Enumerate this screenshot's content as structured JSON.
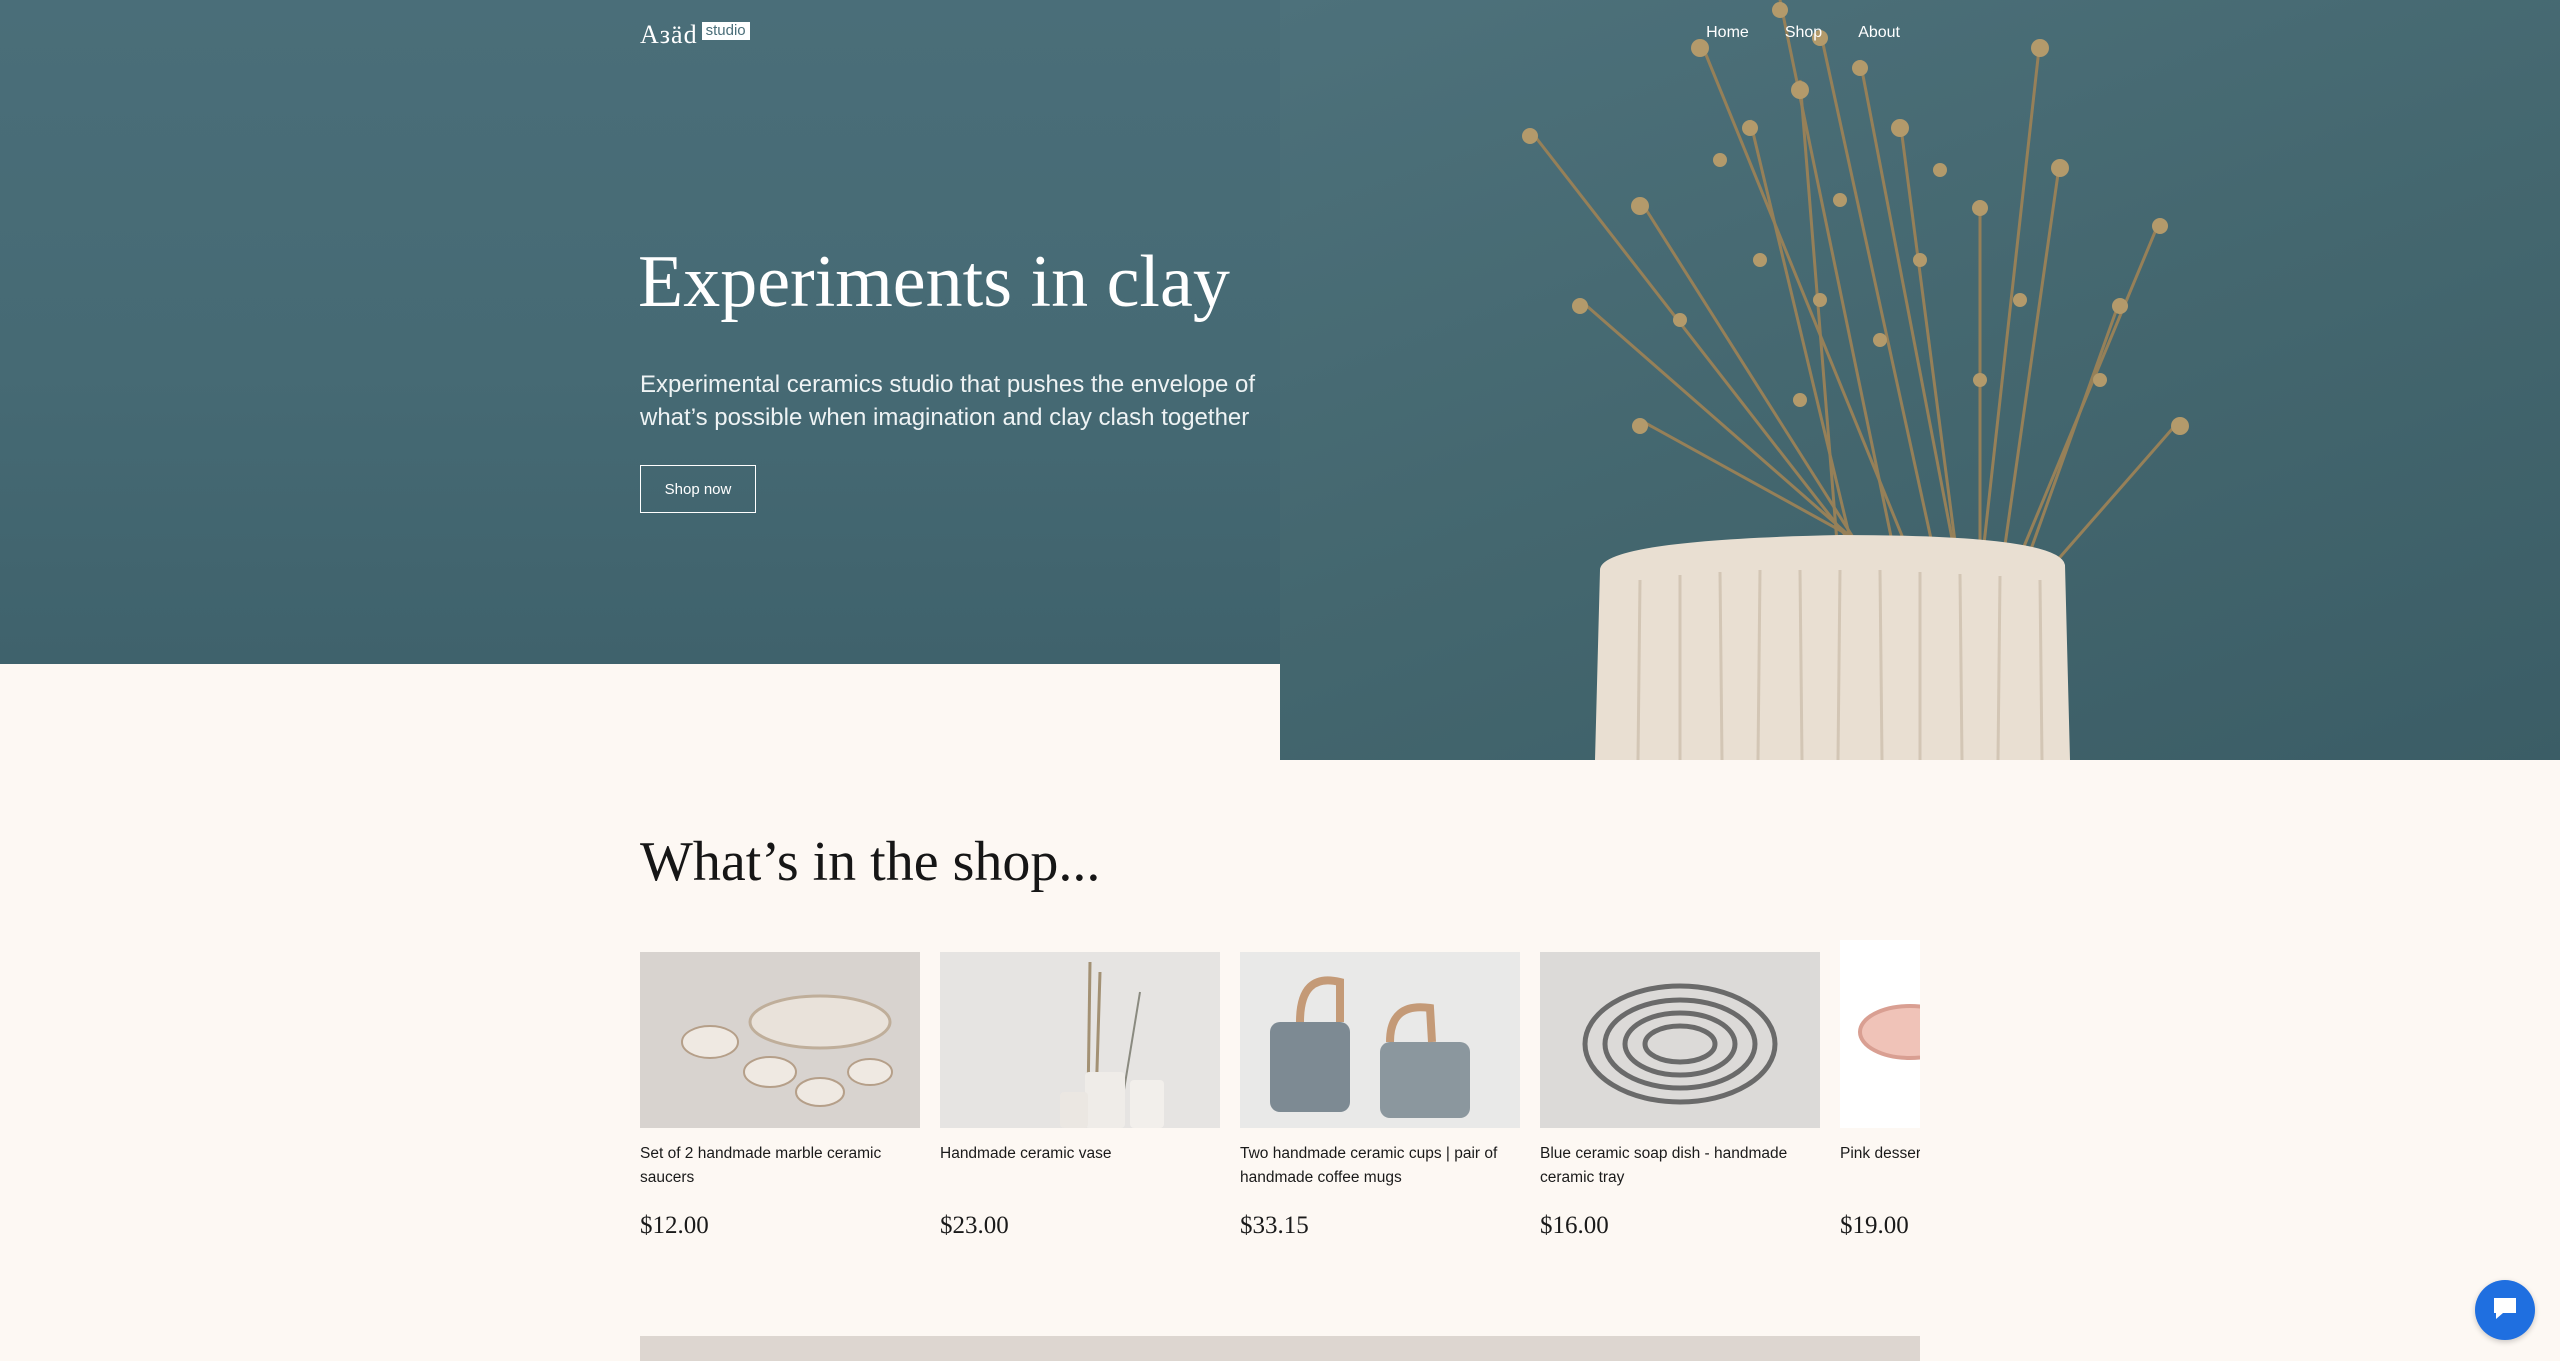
{
  "brand": {
    "name": "Aзäd",
    "badge": "studio"
  },
  "nav": {
    "items": [
      "Home",
      "Shop",
      "About"
    ]
  },
  "hero": {
    "title": "Experiments in clay",
    "subtitle": "Experimental ceramics studio that pushes the envelope of what’s possible when imagination and clay clash together",
    "cta": "Shop now"
  },
  "shop": {
    "title": "What’s in the shop...",
    "products": [
      {
        "name": "Set of 2 handmade marble ceramic saucers",
        "price": "$12.00"
      },
      {
        "name": "Handmade ceramic vase",
        "price": "$23.00"
      },
      {
        "name": "Two handmade ceramic cups | pair of handmade coffee mugs",
        "price": "$33.15"
      },
      {
        "name": "Blue ceramic soap dish - handmade ceramic tray",
        "price": "$16.00"
      },
      {
        "name": "Pink dessert serving plate cake plate",
        "price": "$19.00"
      }
    ]
  },
  "icons": {
    "chat": "chat-bubble-icon"
  },
  "colors": {
    "hero_bg": "#4a6e79",
    "page_bg": "#fdf8f3",
    "chat": "#1f6fe0"
  }
}
